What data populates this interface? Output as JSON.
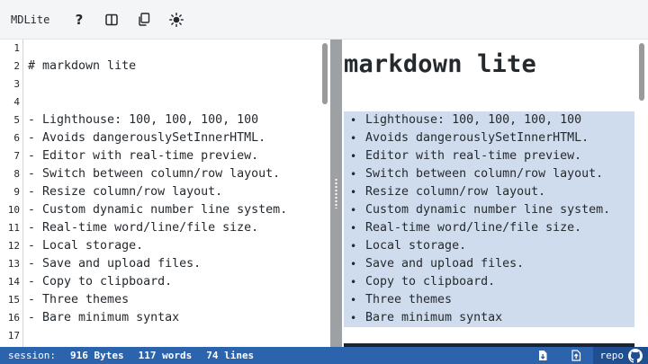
{
  "app": {
    "title": "MDLite"
  },
  "toolbar": {
    "help_label": "?",
    "icons": [
      "help-icon",
      "layout-columns-icon",
      "copy-icon",
      "theme-sun-icon"
    ]
  },
  "editor": {
    "line_numbers": [
      "1",
      "2",
      "3",
      "4",
      "5",
      "6",
      "7",
      "8",
      "9",
      "10",
      "11",
      "12",
      "13",
      "14",
      "15",
      "16",
      "17"
    ],
    "lines": [
      "",
      "# markdown lite",
      "",
      "",
      "- Lighthouse: 100, 100, 100, 100",
      "- Avoids dangerouslySetInnerHTML.",
      "- Editor with real-time preview.",
      "- Switch between column/row layout.",
      "- Resize column/row layout.",
      "- Custom dynamic number line system.",
      "- Real-time word/line/file size.",
      "- Local storage.",
      "- Save and upload files.",
      "- Copy to clipboard.",
      "- Three themes",
      "- Bare minimum syntax",
      ""
    ]
  },
  "preview": {
    "heading": "markdown lite",
    "bullet": "•",
    "items": [
      "Lighthouse: 100, 100, 100, 100",
      "Avoids dangerouslySetInnerHTML.",
      "Editor with real-time preview.",
      "Switch between column/row layout.",
      "Resize column/row layout.",
      "Custom dynamic number line system.",
      "Real-time word/line/file size.",
      "Local storage.",
      "Save and upload files.",
      "Copy to clipboard.",
      "Three themes",
      "Bare minimum syntax"
    ]
  },
  "status": {
    "session_label": "session:",
    "bytes": "916 Bytes",
    "words": "117 words",
    "lines": "74 lines",
    "repo_label": "repo",
    "icons": [
      "download-icon",
      "upload-icon",
      "github-icon"
    ]
  },
  "colors": {
    "status_bar": "#2b63ad",
    "repo_bg": "#1f4f91",
    "selection": "#cfdcee",
    "divider": "#9ea1a4"
  }
}
